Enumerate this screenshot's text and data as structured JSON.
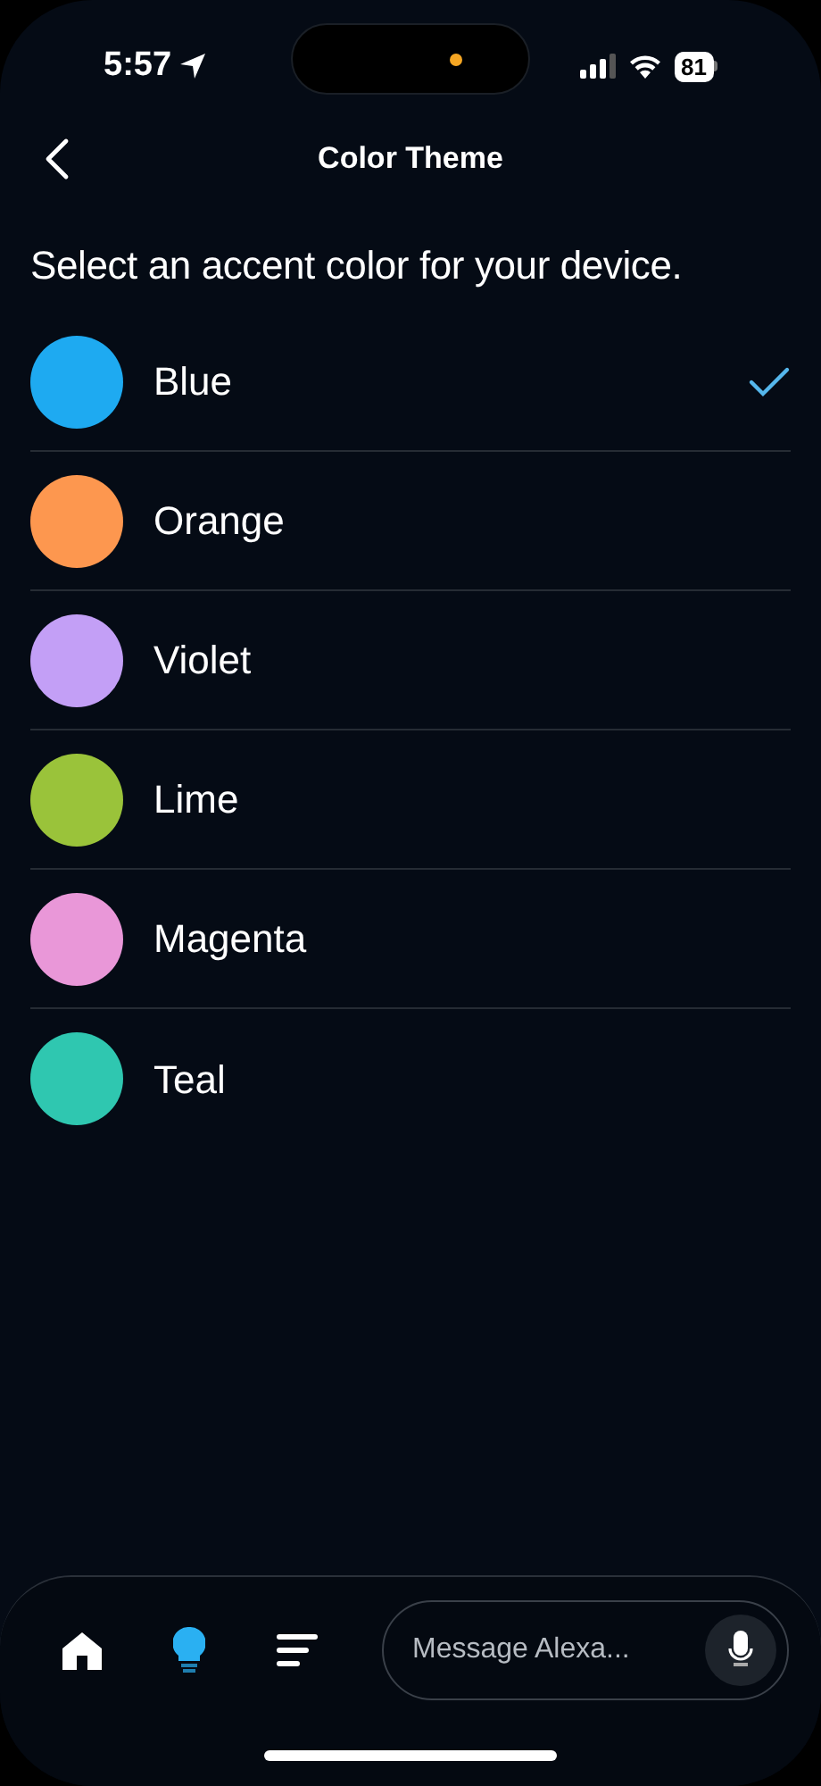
{
  "status_bar": {
    "time": "5:57",
    "battery": "81"
  },
  "header": {
    "title": "Color Theme"
  },
  "prompt": "Select an accent color for your device.",
  "colors": [
    {
      "label": "Blue",
      "color": "#1eaaf1",
      "selected": true
    },
    {
      "label": "Orange",
      "color": "#fd974f",
      "selected": false
    },
    {
      "label": "Violet",
      "color": "#c39ff6",
      "selected": false
    },
    {
      "label": "Lime",
      "color": "#9ac33a",
      "selected": false
    },
    {
      "label": "Magenta",
      "color": "#e997d8",
      "selected": false
    },
    {
      "label": "Teal",
      "color": "#2fc7b0",
      "selected": false
    }
  ],
  "bottom_nav": {
    "items": [
      {
        "kind": "home",
        "selected": false
      },
      {
        "kind": "devices",
        "selected": true
      },
      {
        "kind": "more",
        "selected": false
      }
    ],
    "message_field": {
      "placeholder": "Message Alexa..."
    }
  }
}
